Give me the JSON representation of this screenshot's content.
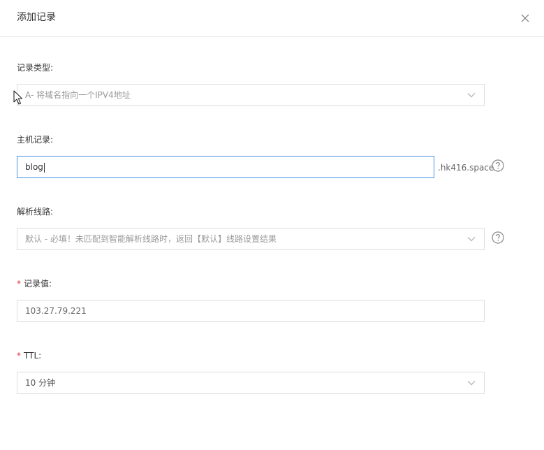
{
  "dialog": {
    "title": "添加记录"
  },
  "form": {
    "record_type": {
      "label": "记录类型:",
      "value": "A- 将域名指向一个IPV4地址"
    },
    "host_record": {
      "label": "主机记录:",
      "value": "blog",
      "suffix": ".hk416.space"
    },
    "line": {
      "label": "解析线路:",
      "value": "默认 - 必填！未匹配到智能解析线路时，返回【默认】线路设置结果"
    },
    "record_value": {
      "required_mark": "*",
      "label": "记录值:",
      "value": "103.27.79.221"
    },
    "ttl": {
      "required_mark": "*",
      "label": "TTL:",
      "value": "10 分钟"
    }
  },
  "icons": {
    "close": "close-icon",
    "chevron": "chevron-down-icon",
    "help": "help-circle-icon",
    "cursor": "mouse-pointer-icon"
  },
  "colors": {
    "focus_border": "#4a90e2",
    "required": "#e0373f",
    "border": "#dcdcdc"
  }
}
